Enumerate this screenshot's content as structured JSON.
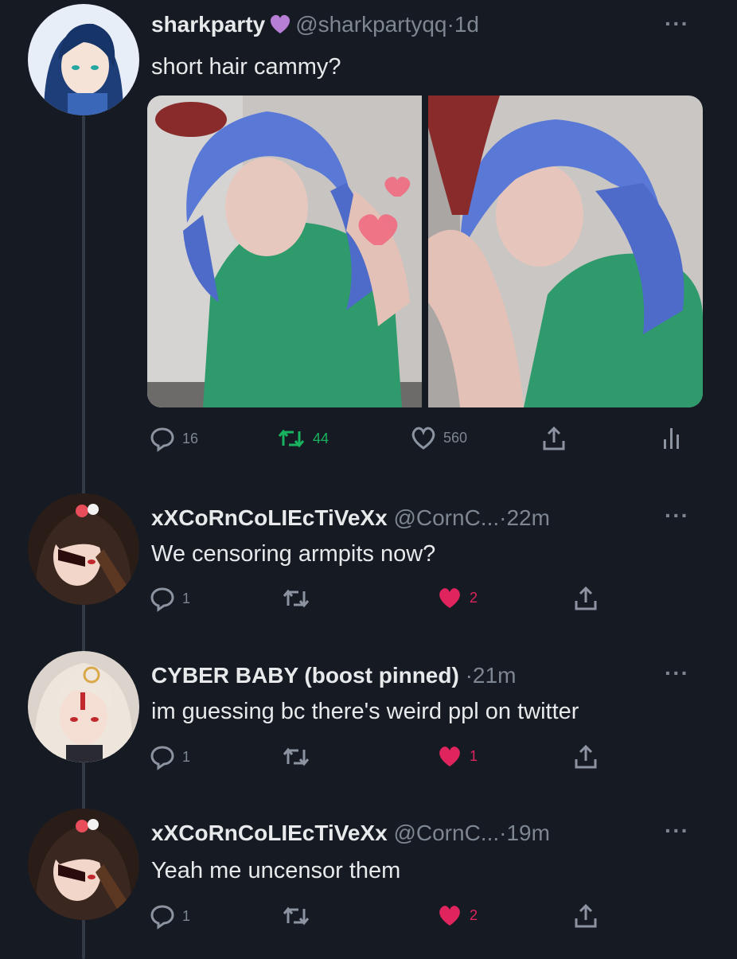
{
  "accent": {
    "retweet_active": "#19b35f",
    "like_active": "#e0245e",
    "muted": "#7d8691",
    "background": "#151a23"
  },
  "tweet": {
    "display_name": "sharkparty",
    "name_badge": "purple-heart-icon",
    "handle": "@sharkpartyqq",
    "sep": "·",
    "time": "1d",
    "more": "···",
    "text": "short hair cammy?",
    "replies": "16",
    "retweets": "44",
    "likes": "560"
  },
  "replies": [
    {
      "display_name": "xXCoRnCoLIEcTiVeXx",
      "handle": "@CornC...",
      "sep": "·",
      "time": "22m",
      "more": "···",
      "text": "We censoring armpits now?",
      "replies": "1",
      "retweets": "",
      "likes": "2",
      "liked": true
    },
    {
      "display_name": "CYBER BABY (boost pinned)",
      "handle": "",
      "sep": "·",
      "time": "21m",
      "more": "···",
      "text": "im guessing bc there's weird ppl on twitter",
      "replies": "1",
      "retweets": "",
      "likes": "1",
      "liked": true
    },
    {
      "display_name": "xXCoRnCoLIEcTiVeXx",
      "handle": "@CornC...",
      "sep": "·",
      "time": "19m",
      "more": "···",
      "text": "Yeah me uncensor them",
      "replies": "1",
      "retweets": "",
      "likes": "2",
      "liked": true
    }
  ]
}
